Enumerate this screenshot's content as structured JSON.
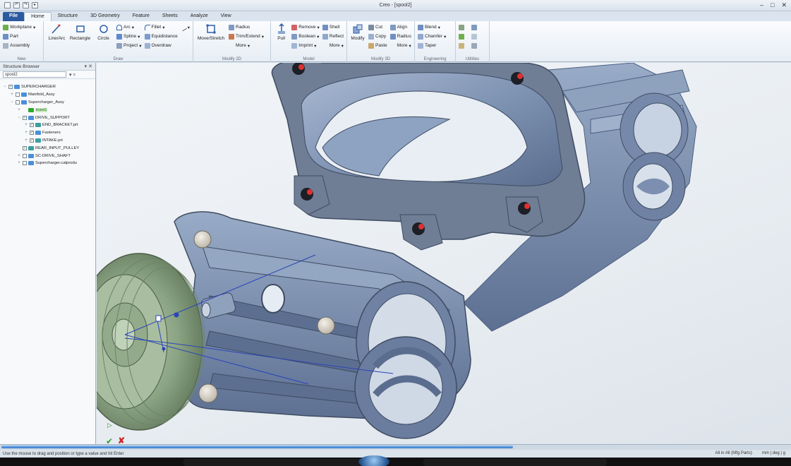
{
  "window": {
    "title": "Creo - [spool2]",
    "qat_icons": [
      "save-icon",
      "undo-icon",
      "redo-icon",
      "select-icon"
    ]
  },
  "ribbon_tabs": [
    "File",
    "Home",
    "Structure",
    "3D Geometry",
    "Feature",
    "Sheets",
    "Analyze",
    "View"
  ],
  "active_tab": "Home",
  "ribbon": {
    "new": {
      "label": "New",
      "items": [
        "Workplane",
        "Part",
        "Assembly"
      ]
    },
    "draw": {
      "label": "Draw",
      "big": [
        "Line/Arc",
        "Rectangle",
        "Circle"
      ],
      "col1": [
        "Arc",
        "Spline",
        "Project"
      ],
      "col2": [
        "Fillet",
        "Equidistance",
        "Overdraw"
      ]
    },
    "modify2d": {
      "label": "Modify 2D",
      "big": [
        "Move/Stretch"
      ],
      "items": [
        "Radius",
        "Trim/Extend",
        "More"
      ]
    },
    "model": {
      "label": "Model",
      "big": [
        "Pull"
      ],
      "col1": [
        "Remove",
        "Boolean",
        "Imprint"
      ],
      "col2": [
        "Shell",
        "Reflect",
        "More"
      ]
    },
    "modify3d": {
      "label": "Modify 3D",
      "big": [
        "Modify"
      ],
      "col1": [
        "Cut",
        "Copy",
        "Paste"
      ],
      "col2": [
        "Align",
        "Radius",
        "More"
      ]
    },
    "engineering": {
      "label": "Engineering",
      "items": [
        "Blend",
        "Chamfer",
        "Taper"
      ]
    },
    "utilities": {
      "label": "Utilities"
    }
  },
  "browser": {
    "title": "Structure Browser",
    "selected_part": "spool2",
    "tree": [
      {
        "label": "SUPERCHARGER",
        "depth": 0,
        "expander": "−",
        "checked": true,
        "icon_color": "#4a8fd8"
      },
      {
        "label": "Manifold_Assy",
        "depth": 1,
        "expander": "+",
        "checked": false,
        "icon_color": "#4a8fd8"
      },
      {
        "label": "Supercharger_Assy",
        "depth": 1,
        "expander": "−",
        "checked": false,
        "icon_color": "#4a8fd8"
      },
      {
        "label": "inset1",
        "depth": 2,
        "expander": "+",
        "checked": null,
        "icon_color": "#2ea82e",
        "highlight": true
      },
      {
        "label": "DRIVE_SUPPORT",
        "depth": 2,
        "expander": "−",
        "checked": true,
        "icon_color": "#4a8fd8"
      },
      {
        "label": "END_BRACKET.prt",
        "depth": 3,
        "expander": "+",
        "checked": true,
        "icon_color": "#3b9e9e"
      },
      {
        "label": "Fasteners",
        "depth": 3,
        "expander": "+",
        "checked": true,
        "icon_color": "#4a8fd8"
      },
      {
        "label": "INTAKE.prt",
        "depth": 3,
        "expander": "+",
        "checked": true,
        "icon_color": "#3b9e9e"
      },
      {
        "label": "REAR_INPUT_PULLEY",
        "depth": 2,
        "expander": "",
        "checked": true,
        "icon_color": "#3b9e9e"
      },
      {
        "label": "SC-DRIVE_SHAFT",
        "depth": 2,
        "expander": "+",
        "checked": false,
        "icon_color": "#4a8fd8"
      },
      {
        "label": "Supercharger.catprodu",
        "depth": 2,
        "expander": "+",
        "checked": false,
        "icon_color": "#4a8fd8"
      }
    ]
  },
  "viewport": {
    "model_color": "#7f93b3",
    "pulley_color": "#8aa383"
  },
  "status": {
    "hint": "Use the mouse to drag and position or type a value and hit Enter",
    "right": [
      "All in All (Mfg Parts)",
      "mm | deg | g"
    ],
    "progress": 0.65
  }
}
